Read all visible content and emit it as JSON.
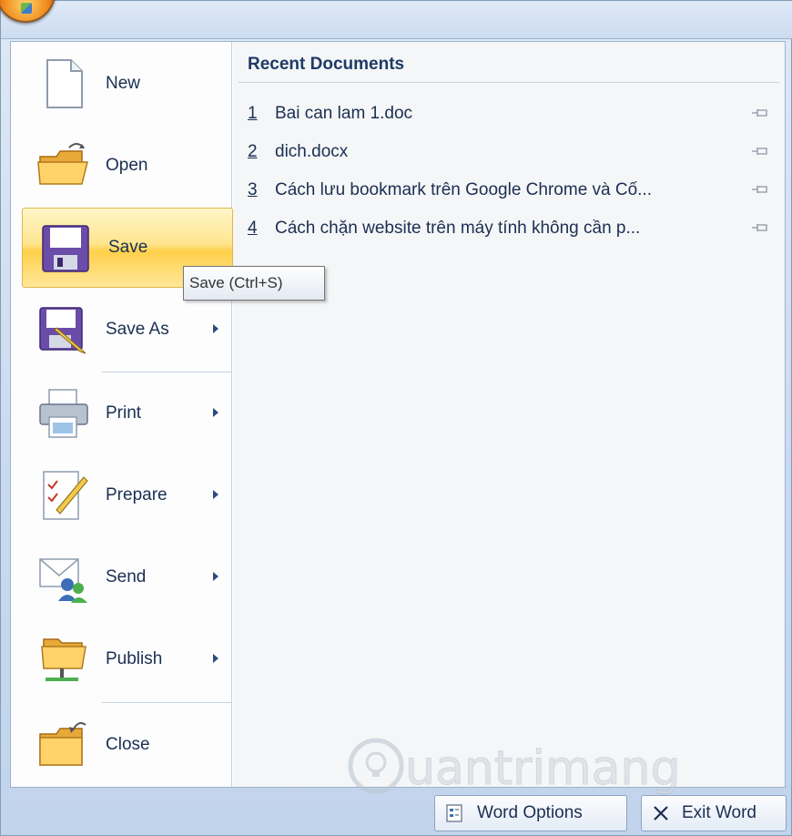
{
  "menu": {
    "items": [
      {
        "label": "New"
      },
      {
        "label": "Open"
      },
      {
        "label": "Save"
      },
      {
        "label": "Save As"
      },
      {
        "label": "Print"
      },
      {
        "label": "Prepare"
      },
      {
        "label": "Send"
      },
      {
        "label": "Publish"
      },
      {
        "label": "Close"
      }
    ]
  },
  "recent": {
    "header": "Recent Documents",
    "items": [
      {
        "num": "1",
        "name": "Bai can lam 1.doc"
      },
      {
        "num": "2",
        "name": "dich.docx"
      },
      {
        "num": "3",
        "name": "Cách lưu bookmark trên Google Chrome và Cố..."
      },
      {
        "num": "4",
        "name": "Cách chặn website trên máy tính không cần p..."
      }
    ]
  },
  "tooltip": {
    "text": "Save (Ctrl+S)"
  },
  "footer": {
    "word_options": "Word Options",
    "exit_word": "Exit Word"
  },
  "watermark": {
    "text": "Quantrimang"
  },
  "colors": {
    "selected_highlight": "#ffd04a",
    "text": "#1a2f52",
    "header": "#1d3a66"
  }
}
